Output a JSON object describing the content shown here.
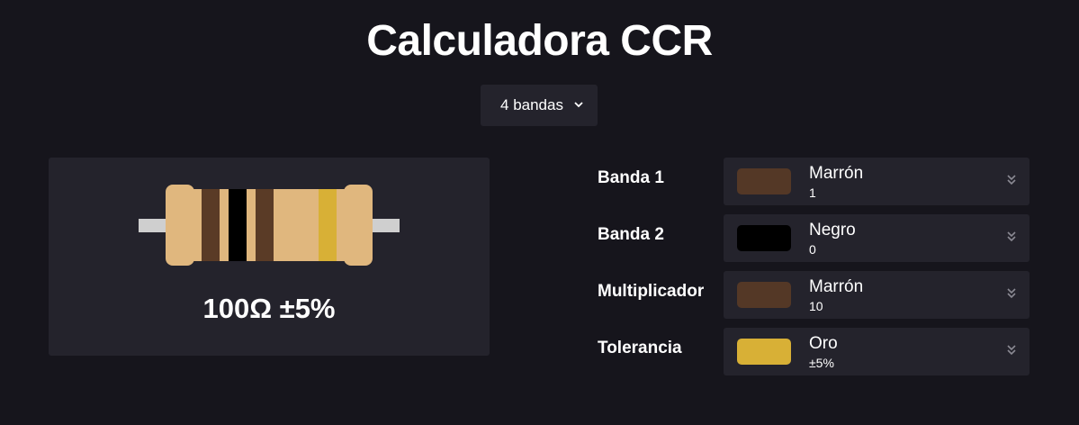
{
  "page": {
    "title": "Calculadora CCR"
  },
  "band_count_select": {
    "selected": "4 bandas"
  },
  "preview": {
    "result": "100Ω ±5%",
    "stripe_colors": [
      "#5a3b26",
      "#000000",
      "#5a3b26",
      "#d8b036"
    ]
  },
  "bands": [
    {
      "label": "Banda 1",
      "color_name": "Marrón",
      "value": "1",
      "swatch": "#543826"
    },
    {
      "label": "Banda 2",
      "color_name": "Negro",
      "value": "0",
      "swatch": "#000000"
    },
    {
      "label": "Multiplicador",
      "color_name": "Marrón",
      "value": "10",
      "swatch": "#543826"
    },
    {
      "label": "Tolerancia",
      "color_name": "Oro",
      "value": "±5%",
      "swatch": "#d8b036"
    }
  ],
  "icons": {
    "dropdown": "chevron-down-icon",
    "select_arrow": "double-chevron-down-icon"
  }
}
